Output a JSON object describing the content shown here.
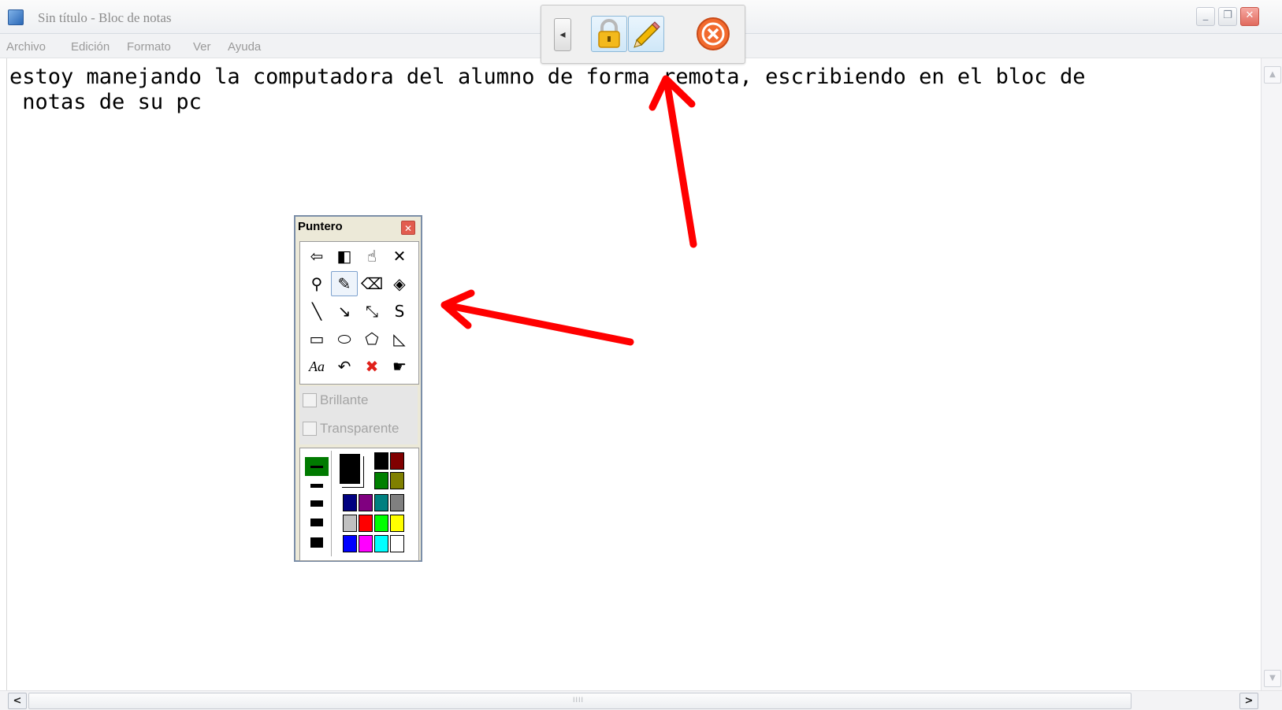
{
  "window": {
    "title": "Sin título - Bloc de notas",
    "controls": {
      "minimize": "_",
      "maximize": "❐",
      "close": "✕"
    }
  },
  "menu": [
    "Archivo",
    "Edición",
    "Formato",
    "Ver",
    "Ayuda"
  ],
  "editor": {
    "text": "estoy manejando la computadora del alumno de forma remota, escribiendo en el bloc de\n notas de su pc"
  },
  "scrollbars": {
    "up": "▲",
    "down": "▼",
    "left": "<",
    "right": ">",
    "grip": "IIII"
  },
  "remote_toolbar": {
    "collapse": "◂",
    "buttons": [
      "lock-icon",
      "pencil-icon",
      "close-icon"
    ]
  },
  "puntero": {
    "title": "Puntero",
    "close": "✕",
    "tools": [
      {
        "icon": "exit-icon",
        "glyph": "⇦"
      },
      {
        "icon": "contrast-icon",
        "glyph": "◧"
      },
      {
        "icon": "hand-icon",
        "glyph": "☝"
      },
      {
        "icon": "clear-icon",
        "glyph": "✕"
      },
      {
        "icon": "magnifier-icon",
        "glyph": "⚲"
      },
      {
        "icon": "pencil-icon",
        "glyph": "✎"
      },
      {
        "icon": "eraser-icon",
        "glyph": "⌫"
      },
      {
        "icon": "paint-bucket-icon",
        "glyph": "◈"
      },
      {
        "icon": "line-icon",
        "glyph": "╲"
      },
      {
        "icon": "arrow-icon",
        "glyph": "↘"
      },
      {
        "icon": "double-arrow-icon",
        "glyph": "⤡"
      },
      {
        "icon": "freehand-icon",
        "glyph": "S"
      },
      {
        "icon": "rectangle-icon",
        "glyph": "▭"
      },
      {
        "icon": "ellipse-icon",
        "glyph": "⬭"
      },
      {
        "icon": "polygon-icon",
        "glyph": "⬠"
      },
      {
        "icon": "filled-polygon-icon",
        "glyph": "◺"
      },
      {
        "icon": "text-icon",
        "glyph": "Aa"
      },
      {
        "icon": "undo-icon",
        "glyph": "↶"
      },
      {
        "icon": "delete-all-icon",
        "glyph": "✖"
      },
      {
        "icon": "remote-pointer-icon",
        "glyph": "☛"
      }
    ],
    "selected_tool": "pencil-icon",
    "options": [
      {
        "label": "Brillante",
        "checked": false
      },
      {
        "label": "Transparente",
        "checked": false
      }
    ],
    "selected_width": 1,
    "current_color": "#000000",
    "palette": [
      "#000000",
      "#800000",
      "#008000",
      "#808000",
      "#000080",
      "#800080",
      "#008080",
      "#808080",
      "#c0c0c0",
      "#ff0000",
      "#00ff00",
      "#ffff00",
      "#0000ff",
      "#ff00ff",
      "#00ffff",
      "#ffffff"
    ]
  },
  "annotation_color": "#ff0000"
}
